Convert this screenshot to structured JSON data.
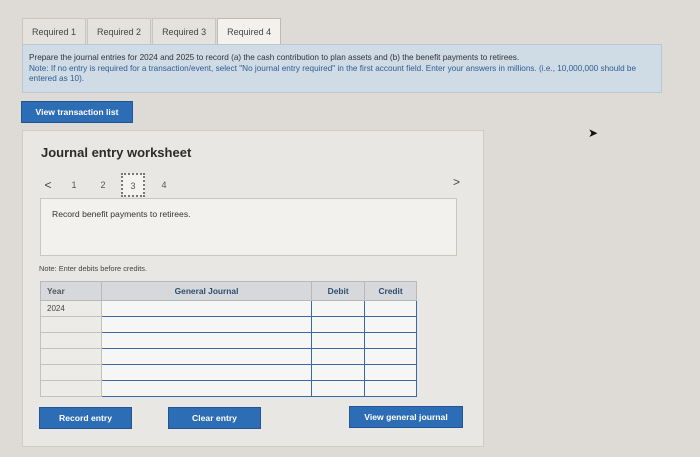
{
  "tabs": [
    {
      "label": "Required 1"
    },
    {
      "label": "Required 2"
    },
    {
      "label": "Required 3"
    },
    {
      "label": "Required 4"
    }
  ],
  "instructions": {
    "main": "Prepare the journal entries for 2024 and 2025 to record (a) the cash contribution to plan assets and (b) the benefit payments to retirees.",
    "note": "Note: If no entry is required for a transaction/event, select \"No journal entry required\" in the first account field. Enter your answers in millions. (i.e., 10,000,000 should be entered as 10)."
  },
  "buttons": {
    "view_transaction_list": "View transaction list",
    "record_entry": "Record entry",
    "clear_entry": "Clear entry",
    "view_general_journal": "View general journal"
  },
  "worksheet": {
    "title": "Journal entry worksheet",
    "prev_arrow": "<",
    "next_arrow": ">",
    "pages": [
      "1",
      "2",
      "3",
      "4"
    ],
    "active_page": "3",
    "description": "Record benefit payments to retirees.",
    "note": "Note: Enter debits before credits."
  },
  "journal_table": {
    "headers": {
      "year": "Year",
      "general_journal": "General Journal",
      "debit": "Debit",
      "credit": "Credit"
    },
    "rows": [
      {
        "year": "2024"
      },
      {
        "year": ""
      },
      {
        "year": ""
      },
      {
        "year": ""
      },
      {
        "year": ""
      },
      {
        "year": ""
      }
    ]
  },
  "colors": {
    "accent": "#2d6db5",
    "instruction_bg": "#cfdbe5",
    "note_text": "#2f5e93"
  }
}
